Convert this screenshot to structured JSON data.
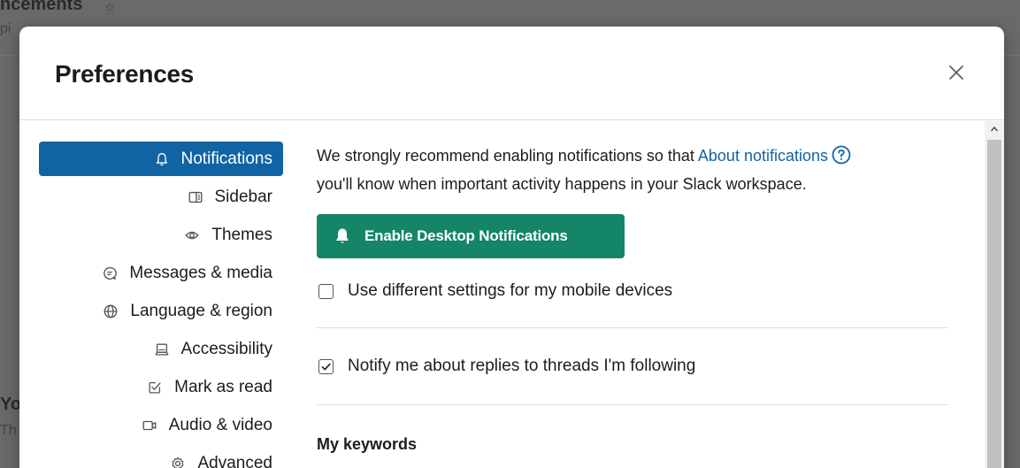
{
  "background": {
    "title_fragment": "ncements",
    "subtitle_fragment": "pi",
    "lower_text_1": "Yo",
    "lower_text_2": "Th"
  },
  "modal": {
    "title": "Preferences",
    "close_icon": "close-icon"
  },
  "nav": {
    "items": [
      {
        "label": "Notifications",
        "icon": "bell-icon",
        "active": true
      },
      {
        "label": "Sidebar",
        "icon": "sidebar-icon",
        "active": false
      },
      {
        "label": "Themes",
        "icon": "eye-icon",
        "active": false
      },
      {
        "label": "Messages & media",
        "icon": "message-icon",
        "active": false
      },
      {
        "label": "Language & region",
        "icon": "globe-icon",
        "active": false
      },
      {
        "label": "Accessibility",
        "icon": "laptop-icon",
        "active": false
      },
      {
        "label": "Mark as read",
        "icon": "mark-read-icon",
        "active": false
      },
      {
        "label": "Audio & video",
        "icon": "video-icon",
        "active": false
      },
      {
        "label": "Advanced",
        "icon": "gear-icon",
        "active": false
      }
    ]
  },
  "content": {
    "intro_before_link": "We strongly recommend enabling notifications so that ",
    "intro_link": "About notifications",
    "intro_after_link": "you'll know when important activity happens in your Slack workspace.",
    "enable_button_label": "Enable Desktop Notifications",
    "mobile_checkbox_label": "Use different settings for my mobile devices",
    "mobile_checked": false,
    "threads_checkbox_label": "Notify me about replies to threads I'm following",
    "threads_checked": true,
    "keywords_heading": "My keywords"
  },
  "colors": {
    "active_nav": "#1164a3",
    "link": "#1264a3",
    "enable_button": "#148567"
  }
}
